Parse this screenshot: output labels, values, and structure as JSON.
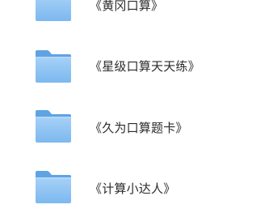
{
  "files": [
    {
      "name": "《黄冈口算》",
      "icon": "folder-icon"
    },
    {
      "name": "《星级口算天天练》",
      "icon": "folder-icon"
    },
    {
      "name": "《久为口算题卡》",
      "icon": "folder-icon"
    },
    {
      "name": "《计算小达人》",
      "icon": "folder-icon"
    }
  ],
  "colors": {
    "folder_front": "#8fc4f3",
    "folder_back": "#6aaeea",
    "folder_tab": "#5fa3e3",
    "text": "#2b2b2b"
  }
}
